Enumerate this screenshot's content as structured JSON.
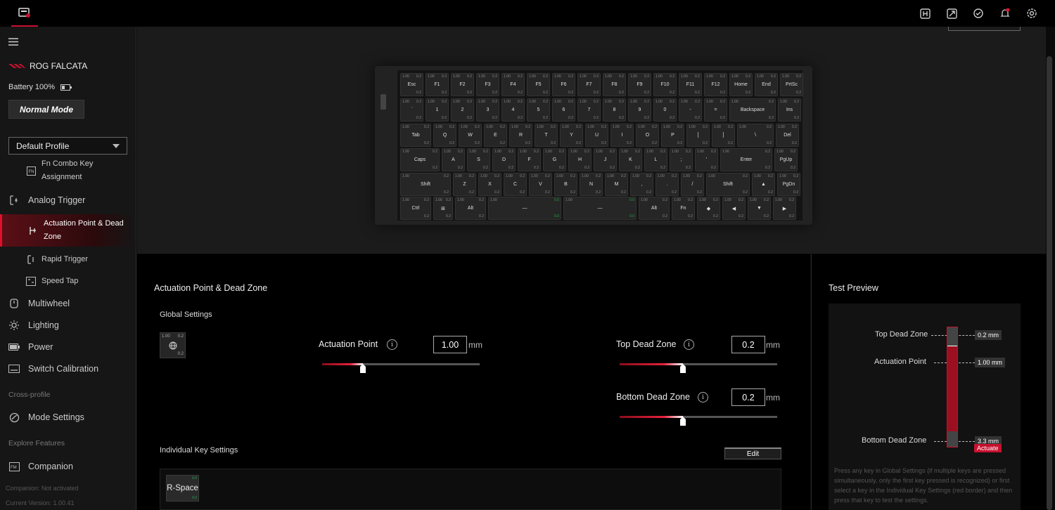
{
  "sidebar": {
    "brand": "ROG FALCATA",
    "battery": "Battery 100%",
    "mode_button": "Normal Mode",
    "profile": "Default Profile",
    "fn_combo": "Fn Combo Key Assignment",
    "analog_trigger": "Analog Trigger",
    "actuation_point": "Actuation Point & Dead Zone",
    "rapid_trigger": "Rapid Trigger",
    "speed_tap": "Speed Tap",
    "multiwheel": "Multiwheel",
    "lighting": "Lighting",
    "power": "Power",
    "switch_calibration": "Switch Calibration",
    "cross_profile": "Cross-profile",
    "mode_settings": "Mode Settings",
    "explore_features": "Explore Features",
    "companion": "Companion",
    "companion_status": "Companion: Not activated",
    "current_version": "Current Version: 1.00.41"
  },
  "keyboard": {
    "rows": [
      [
        "Esc",
        "F1",
        "F2",
        "F3",
        "F4",
        "F5",
        "F6",
        "F7",
        "F8",
        "F9",
        "F10",
        "F11",
        "F12",
        "Home",
        "End",
        "PrtSc"
      ],
      [
        "`",
        "1",
        "2",
        "3",
        "4",
        "5",
        "6",
        "7",
        "8",
        "9",
        "0",
        "-",
        "=",
        "Backspace",
        "Ins"
      ],
      [
        "Tab",
        "Q",
        "W",
        "E",
        "R",
        "T",
        "Y",
        "U",
        "I",
        "O",
        "P",
        "[",
        "]",
        "\\",
        "Del"
      ],
      [
        "Caps",
        "A",
        "S",
        "D",
        "F",
        "G",
        "H",
        "J",
        "K",
        "L",
        ";",
        "'",
        "Enter",
        "PgUp"
      ],
      [
        "Shift",
        "Z",
        "X",
        "C",
        "V",
        "B",
        "N",
        "M",
        ",",
        ".",
        "/",
        "Shift",
        "▲",
        "PgDn"
      ],
      [
        "Ctrl",
        "⊞",
        "Alt",
        "—",
        "—",
        "Alt",
        "Fn",
        "◆",
        "◀",
        "▼",
        "▶"
      ]
    ],
    "default_top_left": "1.00",
    "default_top_right": "0.2",
    "default_bottom_right": "0.2",
    "space_value": "0.0"
  },
  "panel": {
    "title": "Actuation Point & Dead Zone",
    "global_settings": "Global Settings",
    "mini_key": {
      "tl": "1.00",
      "tr": "0.2",
      "br": "0.2"
    },
    "actuation_label": "Actuation Point",
    "actuation_value": "1.00",
    "actuation_fraction": 0.26,
    "top_dead_label": "Top Dead Zone",
    "top_dead_value": "0.2",
    "top_dead_fraction": 0.4,
    "bottom_dead_label": "Bottom Dead Zone",
    "bottom_dead_value": "0.2",
    "bottom_dead_fraction": 0.4,
    "unit": "mm",
    "info_glyph": "i",
    "individual_settings": "Individual Key Settings",
    "edit_button": "Edit",
    "rspace_label": "R-Space",
    "rspace_tr": "0.0",
    "rspace_br": "0.0"
  },
  "test_preview": {
    "title": "Test Preview",
    "top_dead_label": "Top Dead Zone",
    "top_dead_value": "0.2 mm",
    "actuation_label": "Actuation Point",
    "actuation_value": "1.00 mm",
    "bottom_dead_label": "Bottom Dead Zone",
    "bottom_dead_value": "3.3 mm",
    "actuate_badge": "Actuate",
    "hint": "Press any key in Global Settings (if multiple keys are pressed simultaneously, only the first key pressed is recognized) or first select a key in the Individual Key Settings (red border) and then press that key to test the settings."
  },
  "colors": {
    "accent": "#c8102e",
    "background": "#0a0a0a",
    "sidebar": "#161616"
  },
  "icons": [
    "app-logo-icon",
    "hamburger-icon",
    "rog-logo-icon",
    "battery-icon",
    "fn-icon",
    "analog-trigger-icon",
    "actuation-icon",
    "rapid-trigger-icon",
    "speed-tap-icon",
    "multiwheel-icon",
    "lighting-icon",
    "power-icon",
    "switch-calibration-icon",
    "mode-settings-icon",
    "companion-icon",
    "macro-icon",
    "update-icon",
    "sync-icon",
    "bell-icon",
    "gear-icon",
    "info-icon",
    "globe-icon"
  ]
}
